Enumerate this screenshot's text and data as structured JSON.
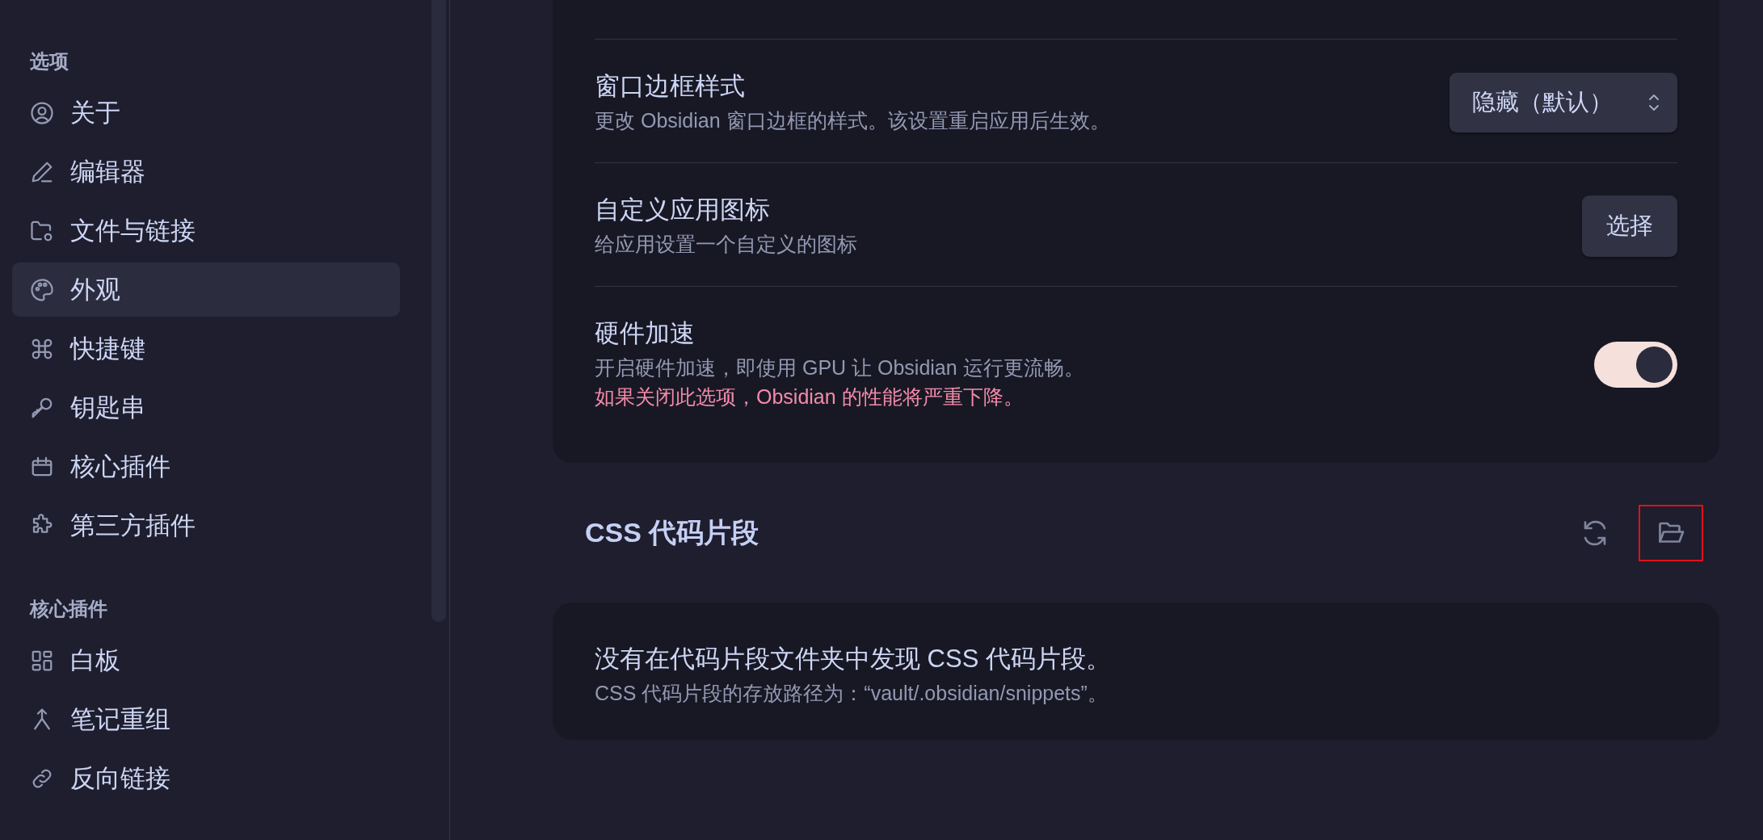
{
  "sidebar": {
    "sections": [
      {
        "heading": "选项",
        "items": [
          {
            "label": "关于",
            "selected": false
          },
          {
            "label": "编辑器",
            "selected": false
          },
          {
            "label": "文件与链接",
            "selected": false
          },
          {
            "label": "外观",
            "selected": true
          },
          {
            "label": "快捷键",
            "selected": false
          },
          {
            "label": "钥匙串",
            "selected": false
          },
          {
            "label": "核心插件",
            "selected": false
          },
          {
            "label": "第三方插件",
            "selected": false
          }
        ]
      },
      {
        "heading": "核心插件",
        "items": [
          {
            "label": "白板",
            "selected": false
          },
          {
            "label": "笔记重组",
            "selected": false
          },
          {
            "label": "反向链接",
            "selected": false
          }
        ]
      }
    ]
  },
  "settings": [
    {
      "title": "窗口边框样式",
      "description": "更改 Obsidian 窗口边框的样式。该设置重启应用后生效。",
      "control": {
        "kind": "dropdown",
        "value": "隐藏（默认）"
      }
    },
    {
      "title": "自定义应用图标",
      "description": "给应用设置一个自定义的图标",
      "control": {
        "kind": "button",
        "label": "选择"
      }
    },
    {
      "title": "硬件加速",
      "description": "开启硬件加速，即使用 GPU 让 Obsidian 运行更流畅。",
      "warning": "如果关闭此选项，Obsidian 的性能将严重下降。",
      "control": {
        "kind": "toggle",
        "on": true
      }
    }
  ],
  "snippets": {
    "heading": "CSS 代码片段",
    "actions": [
      {
        "kind": "reload",
        "highlighted": false
      },
      {
        "kind": "folder",
        "highlighted": true
      }
    ],
    "empty_state": {
      "title": "没有在代码片段文件夹中发现 CSS 代码片段。",
      "description": "CSS 代码片段的存放路径为：“vault/.obsidian/snippets”。"
    }
  }
}
